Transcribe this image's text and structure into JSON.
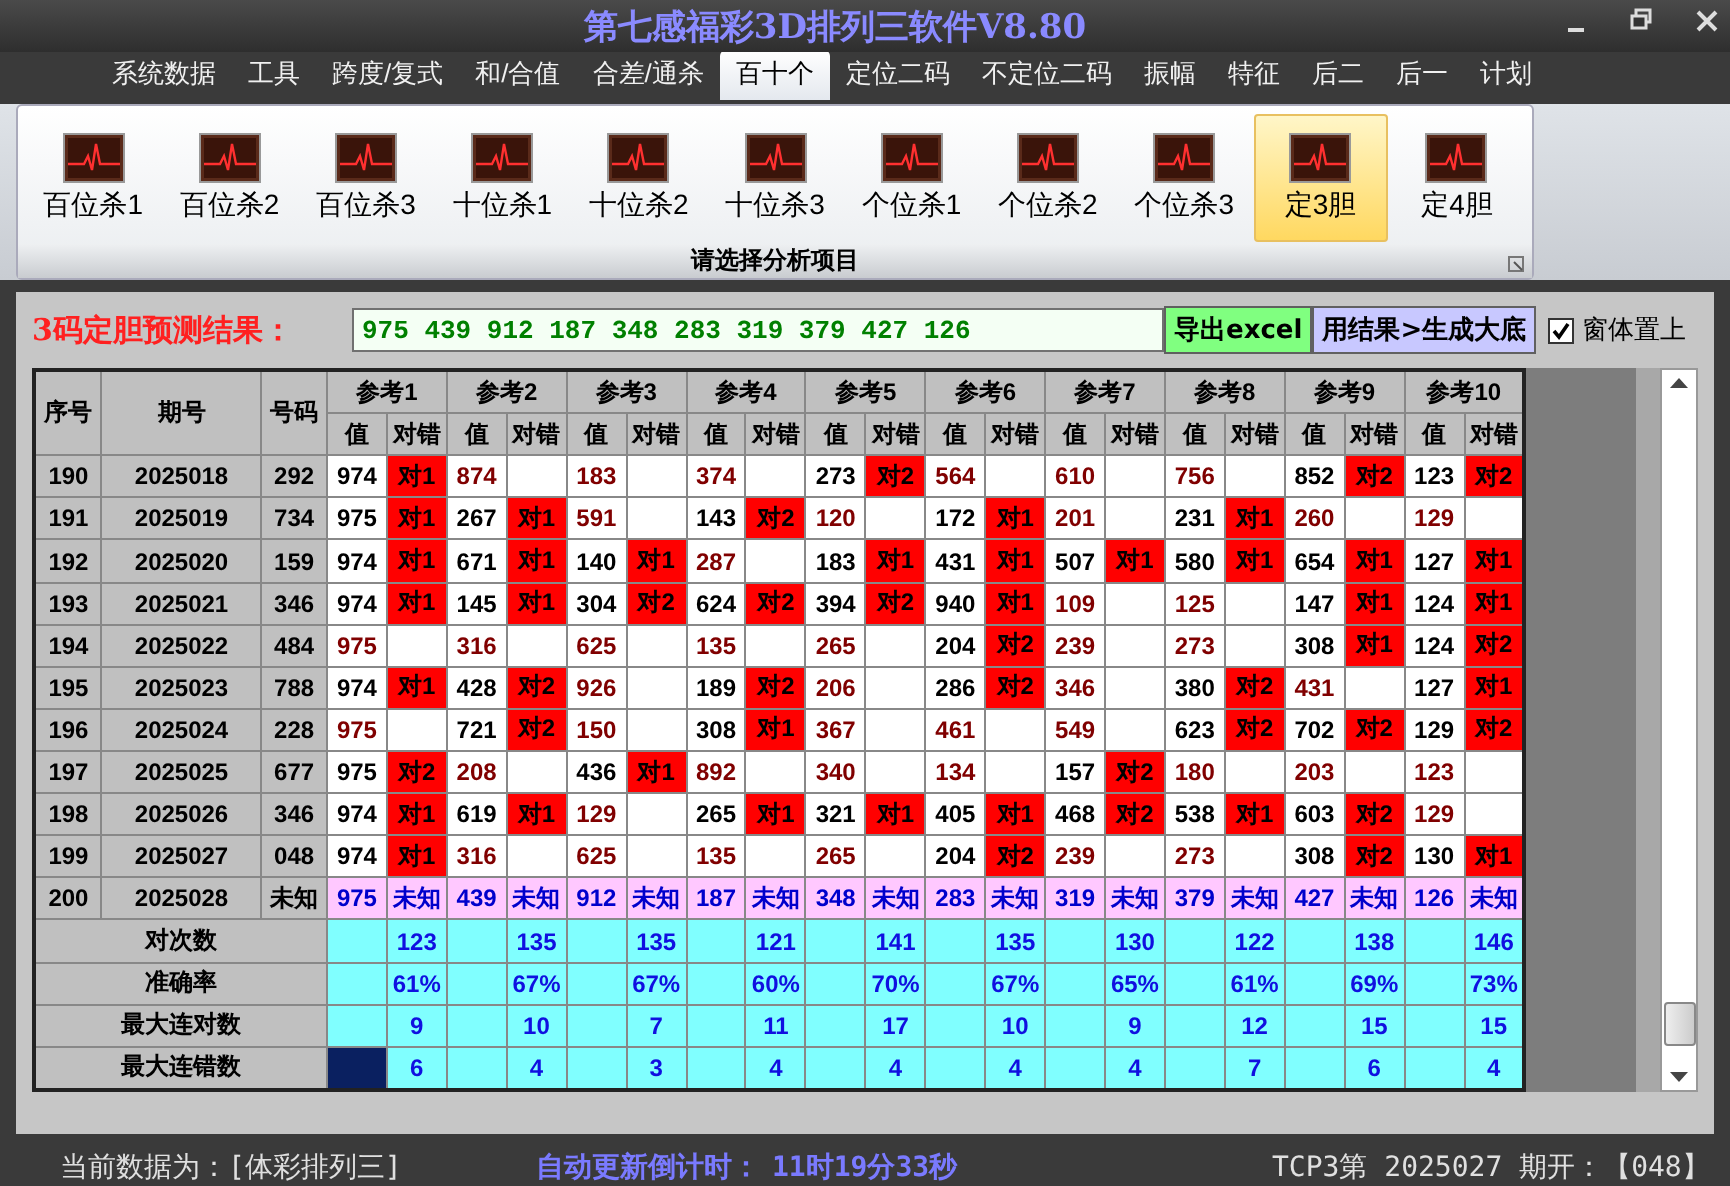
{
  "window": {
    "title": "第七感福彩3D排列三软件V8.80"
  },
  "menu": [
    {
      "label": "系统数据",
      "selected": false
    },
    {
      "label": "工具",
      "selected": false
    },
    {
      "label": "跨度/复式",
      "selected": false
    },
    {
      "label": "和/合值",
      "selected": false
    },
    {
      "label": "合差/通杀",
      "selected": false
    },
    {
      "label": "百十个",
      "selected": true
    },
    {
      "label": "定位二码",
      "selected": false
    },
    {
      "label": "不定位二码",
      "selected": false
    },
    {
      "label": "振幅",
      "selected": false
    },
    {
      "label": "特征",
      "selected": false
    },
    {
      "label": "后二",
      "selected": false
    },
    {
      "label": "后一",
      "selected": false
    },
    {
      "label": "计划",
      "selected": false
    }
  ],
  "ribbon": {
    "items": [
      {
        "label": "百位杀1",
        "selected": false
      },
      {
        "label": "百位杀2",
        "selected": false
      },
      {
        "label": "百位杀3",
        "selected": false
      },
      {
        "label": "十位杀1",
        "selected": false
      },
      {
        "label": "十位杀2",
        "selected": false
      },
      {
        "label": "十位杀3",
        "selected": false
      },
      {
        "label": "个位杀1",
        "selected": false
      },
      {
        "label": "个位杀2",
        "selected": false
      },
      {
        "label": "个位杀3",
        "selected": false
      },
      {
        "label": "定3胆",
        "selected": true
      },
      {
        "label": "定4胆",
        "selected": false
      }
    ],
    "caption": "请选择分析项目"
  },
  "prediction": {
    "label": "3码定胆预测结果：",
    "value": "975 439 912 187 348 283 319 379 427 126",
    "buttons": [
      {
        "label": "导出excel",
        "kind": "export"
      },
      {
        "label": "用结果>生成大底",
        "kind": "generate"
      }
    ],
    "on_top": {
      "label": "窗体置上",
      "checked": true
    }
  },
  "table": {
    "columns": [
      "序号",
      "期号",
      "号码"
    ],
    "ref_groups": [
      {
        "title": "参考1",
        "sub_columns": [
          "值",
          "对错"
        ]
      },
      {
        "title": "参考2",
        "sub_columns": [
          "值",
          "对错"
        ]
      },
      {
        "title": "参考3",
        "sub_columns": [
          "值",
          "对错"
        ]
      },
      {
        "title": "参考4",
        "sub_columns": [
          "值",
          "对错"
        ]
      },
      {
        "title": "参考5",
        "sub_columns": [
          "值",
          "对错"
        ]
      },
      {
        "title": "参考6",
        "sub_columns": [
          "值",
          "对错"
        ]
      },
      {
        "title": "参考7",
        "sub_columns": [
          "值",
          "对错"
        ]
      },
      {
        "title": "参考8",
        "sub_columns": [
          "值",
          "对错"
        ]
      },
      {
        "title": "参考9",
        "sub_columns": [
          "值",
          "对错"
        ]
      },
      {
        "title": "参考10",
        "sub_columns": [
          "值",
          "对错"
        ]
      }
    ],
    "rows": [
      {
        "kind": "history",
        "index": "190",
        "issue": "2025018",
        "code": "292",
        "refs": [
          {
            "value": "974",
            "result": "对1",
            "hit": true
          },
          {
            "value": "874",
            "hit": false
          },
          {
            "value": "183",
            "hit": false
          },
          {
            "value": "374",
            "hit": false
          },
          {
            "value": "273",
            "result": "对2",
            "hit": true
          },
          {
            "value": "564",
            "hit": false
          },
          {
            "value": "610",
            "hit": false
          },
          {
            "value": "756",
            "hit": false
          },
          {
            "value": "852",
            "result": "对2",
            "hit": true
          },
          {
            "value": "123",
            "result": "对2",
            "hit": true
          }
        ]
      },
      {
        "kind": "history",
        "index": "191",
        "issue": "2025019",
        "code": "734",
        "refs": [
          {
            "value": "975",
            "result": "对1",
            "hit": true
          },
          {
            "value": "267",
            "result": "对1",
            "hit": true
          },
          {
            "value": "591",
            "hit": false
          },
          {
            "value": "143",
            "result": "对2",
            "hit": true
          },
          {
            "value": "120",
            "hit": false
          },
          {
            "value": "172",
            "result": "对1",
            "hit": true
          },
          {
            "value": "201",
            "hit": false
          },
          {
            "value": "231",
            "result": "对1",
            "hit": true
          },
          {
            "value": "260",
            "hit": false
          },
          {
            "value": "129",
            "hit": false
          }
        ]
      },
      {
        "kind": "history",
        "index": "192",
        "issue": "2025020",
        "code": "159",
        "refs": [
          {
            "value": "974",
            "result": "对1",
            "hit": true
          },
          {
            "value": "671",
            "result": "对1",
            "hit": true
          },
          {
            "value": "140",
            "result": "对1",
            "hit": true
          },
          {
            "value": "287",
            "hit": false
          },
          {
            "value": "183",
            "result": "对1",
            "hit": true
          },
          {
            "value": "431",
            "result": "对1",
            "hit": true
          },
          {
            "value": "507",
            "result": "对1",
            "hit": true
          },
          {
            "value": "580",
            "result": "对1",
            "hit": true
          },
          {
            "value": "654",
            "result": "对1",
            "hit": true
          },
          {
            "value": "127",
            "result": "对1",
            "hit": true
          }
        ]
      },
      {
        "kind": "history",
        "index": "193",
        "issue": "2025021",
        "code": "346",
        "refs": [
          {
            "value": "974",
            "result": "对1",
            "hit": true
          },
          {
            "value": "145",
            "result": "对1",
            "hit": true
          },
          {
            "value": "304",
            "result": "对2",
            "hit": true
          },
          {
            "value": "624",
            "result": "对2",
            "hit": true
          },
          {
            "value": "394",
            "result": "对2",
            "hit": true
          },
          {
            "value": "940",
            "result": "对1",
            "hit": true
          },
          {
            "value": "109",
            "hit": false
          },
          {
            "value": "125",
            "hit": false
          },
          {
            "value": "147",
            "result": "对1",
            "hit": true
          },
          {
            "value": "124",
            "result": "对1",
            "hit": true
          }
        ]
      },
      {
        "kind": "history",
        "index": "194",
        "issue": "2025022",
        "code": "484",
        "refs": [
          {
            "value": "975",
            "hit": false
          },
          {
            "value": "316",
            "hit": false
          },
          {
            "value": "625",
            "hit": false
          },
          {
            "value": "135",
            "hit": false
          },
          {
            "value": "265",
            "hit": false
          },
          {
            "value": "204",
            "result": "对2",
            "hit": true
          },
          {
            "value": "239",
            "hit": false
          },
          {
            "value": "273",
            "hit": false
          },
          {
            "value": "308",
            "result": "对1",
            "hit": true
          },
          {
            "value": "124",
            "result": "对2",
            "hit": true
          }
        ]
      },
      {
        "kind": "history",
        "index": "195",
        "issue": "2025023",
        "code": "788",
        "refs": [
          {
            "value": "974",
            "result": "对1",
            "hit": true
          },
          {
            "value": "428",
            "result": "对2",
            "hit": true
          },
          {
            "value": "926",
            "hit": false
          },
          {
            "value": "189",
            "result": "对2",
            "hit": true
          },
          {
            "value": "206",
            "hit": false
          },
          {
            "value": "286",
            "result": "对2",
            "hit": true
          },
          {
            "value": "346",
            "hit": false
          },
          {
            "value": "380",
            "result": "对2",
            "hit": true
          },
          {
            "value": "431",
            "hit": false
          },
          {
            "value": "127",
            "result": "对1",
            "hit": true
          }
        ]
      },
      {
        "kind": "history",
        "index": "196",
        "issue": "2025024",
        "code": "228",
        "refs": [
          {
            "value": "975",
            "hit": false
          },
          {
            "value": "721",
            "result": "对2",
            "hit": true
          },
          {
            "value": "150",
            "hit": false
          },
          {
            "value": "308",
            "result": "对1",
            "hit": true
          },
          {
            "value": "367",
            "hit": false
          },
          {
            "value": "461",
            "hit": false
          },
          {
            "value": "549",
            "hit": false
          },
          {
            "value": "623",
            "result": "对2",
            "hit": true
          },
          {
            "value": "702",
            "result": "对2",
            "hit": true
          },
          {
            "value": "129",
            "result": "对2",
            "hit": true
          }
        ]
      },
      {
        "kind": "history",
        "index": "197",
        "issue": "2025025",
        "code": "677",
        "refs": [
          {
            "value": "975",
            "result": "对2",
            "hit": true
          },
          {
            "value": "208",
            "hit": false
          },
          {
            "value": "436",
            "result": "对1",
            "hit": true
          },
          {
            "value": "892",
            "hit": false
          },
          {
            "value": "340",
            "hit": false
          },
          {
            "value": "134",
            "hit": false
          },
          {
            "value": "157",
            "result": "对2",
            "hit": true
          },
          {
            "value": "180",
            "hit": false
          },
          {
            "value": "203",
            "hit": false
          },
          {
            "value": "123",
            "hit": false
          }
        ]
      },
      {
        "kind": "history",
        "index": "198",
        "issue": "2025026",
        "code": "346",
        "refs": [
          {
            "value": "974",
            "result": "对1",
            "hit": true
          },
          {
            "value": "619",
            "result": "对1",
            "hit": true
          },
          {
            "value": "129",
            "hit": false
          },
          {
            "value": "265",
            "result": "对1",
            "hit": true
          },
          {
            "value": "321",
            "result": "对1",
            "hit": true
          },
          {
            "value": "405",
            "result": "对1",
            "hit": true
          },
          {
            "value": "468",
            "result": "对2",
            "hit": true
          },
          {
            "value": "538",
            "result": "对1",
            "hit": true
          },
          {
            "value": "603",
            "result": "对2",
            "hit": true
          },
          {
            "value": "129",
            "hit": false
          }
        ]
      },
      {
        "kind": "history",
        "index": "199",
        "issue": "2025027",
        "code": "048",
        "refs": [
          {
            "value": "974",
            "result": "对1",
            "hit": true
          },
          {
            "value": "316",
            "hit": false
          },
          {
            "value": "625",
            "hit": false
          },
          {
            "value": "135",
            "hit": false
          },
          {
            "value": "265",
            "hit": false
          },
          {
            "value": "204",
            "result": "对2",
            "hit": true
          },
          {
            "value": "239",
            "hit": false
          },
          {
            "value": "273",
            "hit": false
          },
          {
            "value": "308",
            "result": "对2",
            "hit": true
          },
          {
            "value": "130",
            "result": "对1",
            "hit": true
          }
        ]
      },
      {
        "kind": "forecast",
        "index": "200",
        "issue": "2025028",
        "code": "未知",
        "refs": [
          {
            "value": "975",
            "result": "未知"
          },
          {
            "value": "439",
            "result": "未知"
          },
          {
            "value": "912",
            "result": "未知"
          },
          {
            "value": "187",
            "result": "未知"
          },
          {
            "value": "348",
            "result": "未知"
          },
          {
            "value": "283",
            "result": "未知"
          },
          {
            "value": "319",
            "result": "未知"
          },
          {
            "value": "379",
            "result": "未知"
          },
          {
            "value": "427",
            "result": "未知"
          },
          {
            "value": "126",
            "result": "未知"
          }
        ]
      }
    ],
    "stats": [
      {
        "label": "对次数",
        "values": [
          {
            "text": "123",
            "focused": false
          },
          {
            "text": "135",
            "focused": false
          },
          {
            "text": "135",
            "focused": false
          },
          {
            "text": "121",
            "focused": false
          },
          {
            "text": "141",
            "focused": false
          },
          {
            "text": "135",
            "focused": false
          },
          {
            "text": "130",
            "focused": false
          },
          {
            "text": "122",
            "focused": false
          },
          {
            "text": "138",
            "focused": false
          },
          {
            "text": "146",
            "focused": false
          }
        ]
      },
      {
        "label": "准确率",
        "values": [
          {
            "text": "61%",
            "focused": false
          },
          {
            "text": "67%",
            "focused": false
          },
          {
            "text": "67%",
            "focused": false
          },
          {
            "text": "60%",
            "focused": false
          },
          {
            "text": "70%",
            "focused": false
          },
          {
            "text": "67%",
            "focused": false
          },
          {
            "text": "65%",
            "focused": false
          },
          {
            "text": "61%",
            "focused": false
          },
          {
            "text": "69%",
            "focused": false
          },
          {
            "text": "73%",
            "focused": false
          }
        ]
      },
      {
        "label": "最大连对数",
        "values": [
          {
            "text": "9",
            "focused": false
          },
          {
            "text": "10",
            "focused": false
          },
          {
            "text": "7",
            "focused": false
          },
          {
            "text": "11",
            "focused": false
          },
          {
            "text": "17",
            "focused": false
          },
          {
            "text": "10",
            "focused": false
          },
          {
            "text": "9",
            "focused": false
          },
          {
            "text": "12",
            "focused": false
          },
          {
            "text": "15",
            "focused": false
          },
          {
            "text": "15",
            "focused": false
          }
        ]
      },
      {
        "label": "最大连错数",
        "values": [
          {
            "text": "6",
            "focused": true
          },
          {
            "text": "4",
            "focused": false
          },
          {
            "text": "3",
            "focused": false
          },
          {
            "text": "4",
            "focused": false
          },
          {
            "text": "4",
            "focused": false
          },
          {
            "text": "4",
            "focused": false
          },
          {
            "text": "4",
            "focused": false
          },
          {
            "text": "7",
            "focused": false
          },
          {
            "text": "6",
            "focused": false
          },
          {
            "text": "4",
            "focused": false
          }
        ]
      }
    ]
  },
  "status_bar": {
    "data_source": "当前数据为：[体彩排列三]",
    "countdown_label": "自动更新倒计时：",
    "countdown": "11时19分33秒",
    "latest": "TCP3第 2025027 期开：【048】"
  }
}
